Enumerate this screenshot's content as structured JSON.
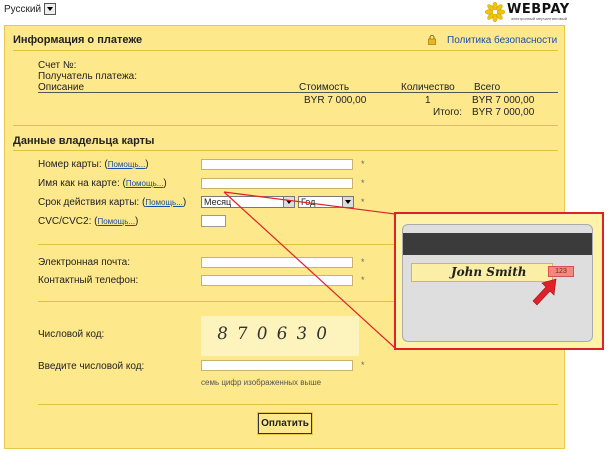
{
  "language": {
    "selected": "Русский"
  },
  "logo": {
    "word": "WEBPAY",
    "tagline": "электронный мерчантинговый"
  },
  "payment_info": {
    "title": "Информация о платеже",
    "security_link": "Политика безопасности",
    "account_label": "Счет №:",
    "recipient_label": "Получатель платежа:",
    "table": {
      "headers": {
        "description": "Описание",
        "cost": "Стоимость",
        "quantity": "Количество",
        "total": "Всего"
      },
      "row": {
        "cost": "BYR 7 000,00",
        "quantity": "1",
        "total": "BYR 7 000,00"
      },
      "grand_total_label": "Итого:",
      "grand_total_value": "BYR 7 000,00"
    }
  },
  "card_holder": {
    "title": "Данные владельца карты",
    "help_text": "Помощь...",
    "card_number_label": "Номер карты:",
    "name_label": "Имя как на карте:",
    "expiry_label": "Срок действия карты:",
    "month_value": "Месяц",
    "year_value": "Год",
    "cvc_label": "CVC/CVC2:",
    "email_label": "Электронная почта:",
    "phone_label": "Контактный телефон:",
    "numeric_code_label": "Числовой код:",
    "captcha_text": "870630",
    "enter_code_label": "Введите числовой код:",
    "code_hint": "семь цифр изображенных выше",
    "required_mark": "*",
    "pay_button": "Оплатить"
  },
  "card_illustration": {
    "name": "John Smith",
    "cvc_text": "123"
  },
  "colors": {
    "panel": "#fde98c",
    "link": "#1a4fa0",
    "callout_border": "#e0202a",
    "arrow": "#e0202a"
  }
}
